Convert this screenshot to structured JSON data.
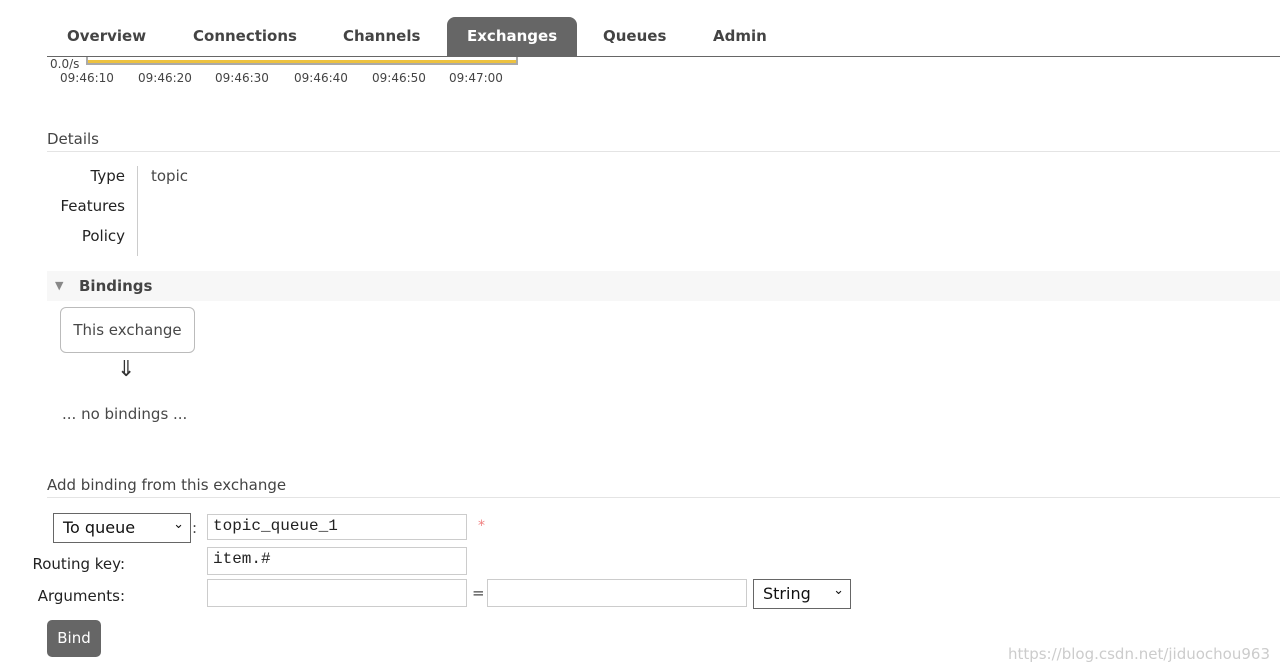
{
  "nav": {
    "tabs": [
      "Overview",
      "Connections",
      "Channels",
      "Exchanges",
      "Queues",
      "Admin"
    ],
    "active": "Exchanges"
  },
  "chart_data": {
    "type": "line",
    "ylabel_tick": "0.0/s",
    "x_ticks": [
      "09:46:10",
      "09:46:20",
      "09:46:30",
      "09:46:40",
      "09:46:50",
      "09:47:00"
    ],
    "series": [
      {
        "values": [
          0,
          0,
          0,
          0,
          0,
          0
        ]
      }
    ],
    "color": "#edc240"
  },
  "details": {
    "title": "Details",
    "type_label": "Type",
    "type_value": "topic",
    "features_label": "Features",
    "policy_label": "Policy"
  },
  "bindings": {
    "title": "Bindings",
    "this_exchange": "This exchange",
    "arrow": "⇓",
    "empty": "... no bindings ..."
  },
  "add_binding": {
    "title": "Add binding from this exchange",
    "destination_type": "To queue",
    "destination": "topic_queue_1",
    "required": "*",
    "routing_key_label": "Routing key:",
    "routing_key": "item.#",
    "arguments_label": "Arguments:",
    "equals": "=",
    "arg_type": "String",
    "bind_label": "Bind",
    "colon": ":"
  },
  "watermark": "https://blog.csdn.net/jiduochou963"
}
